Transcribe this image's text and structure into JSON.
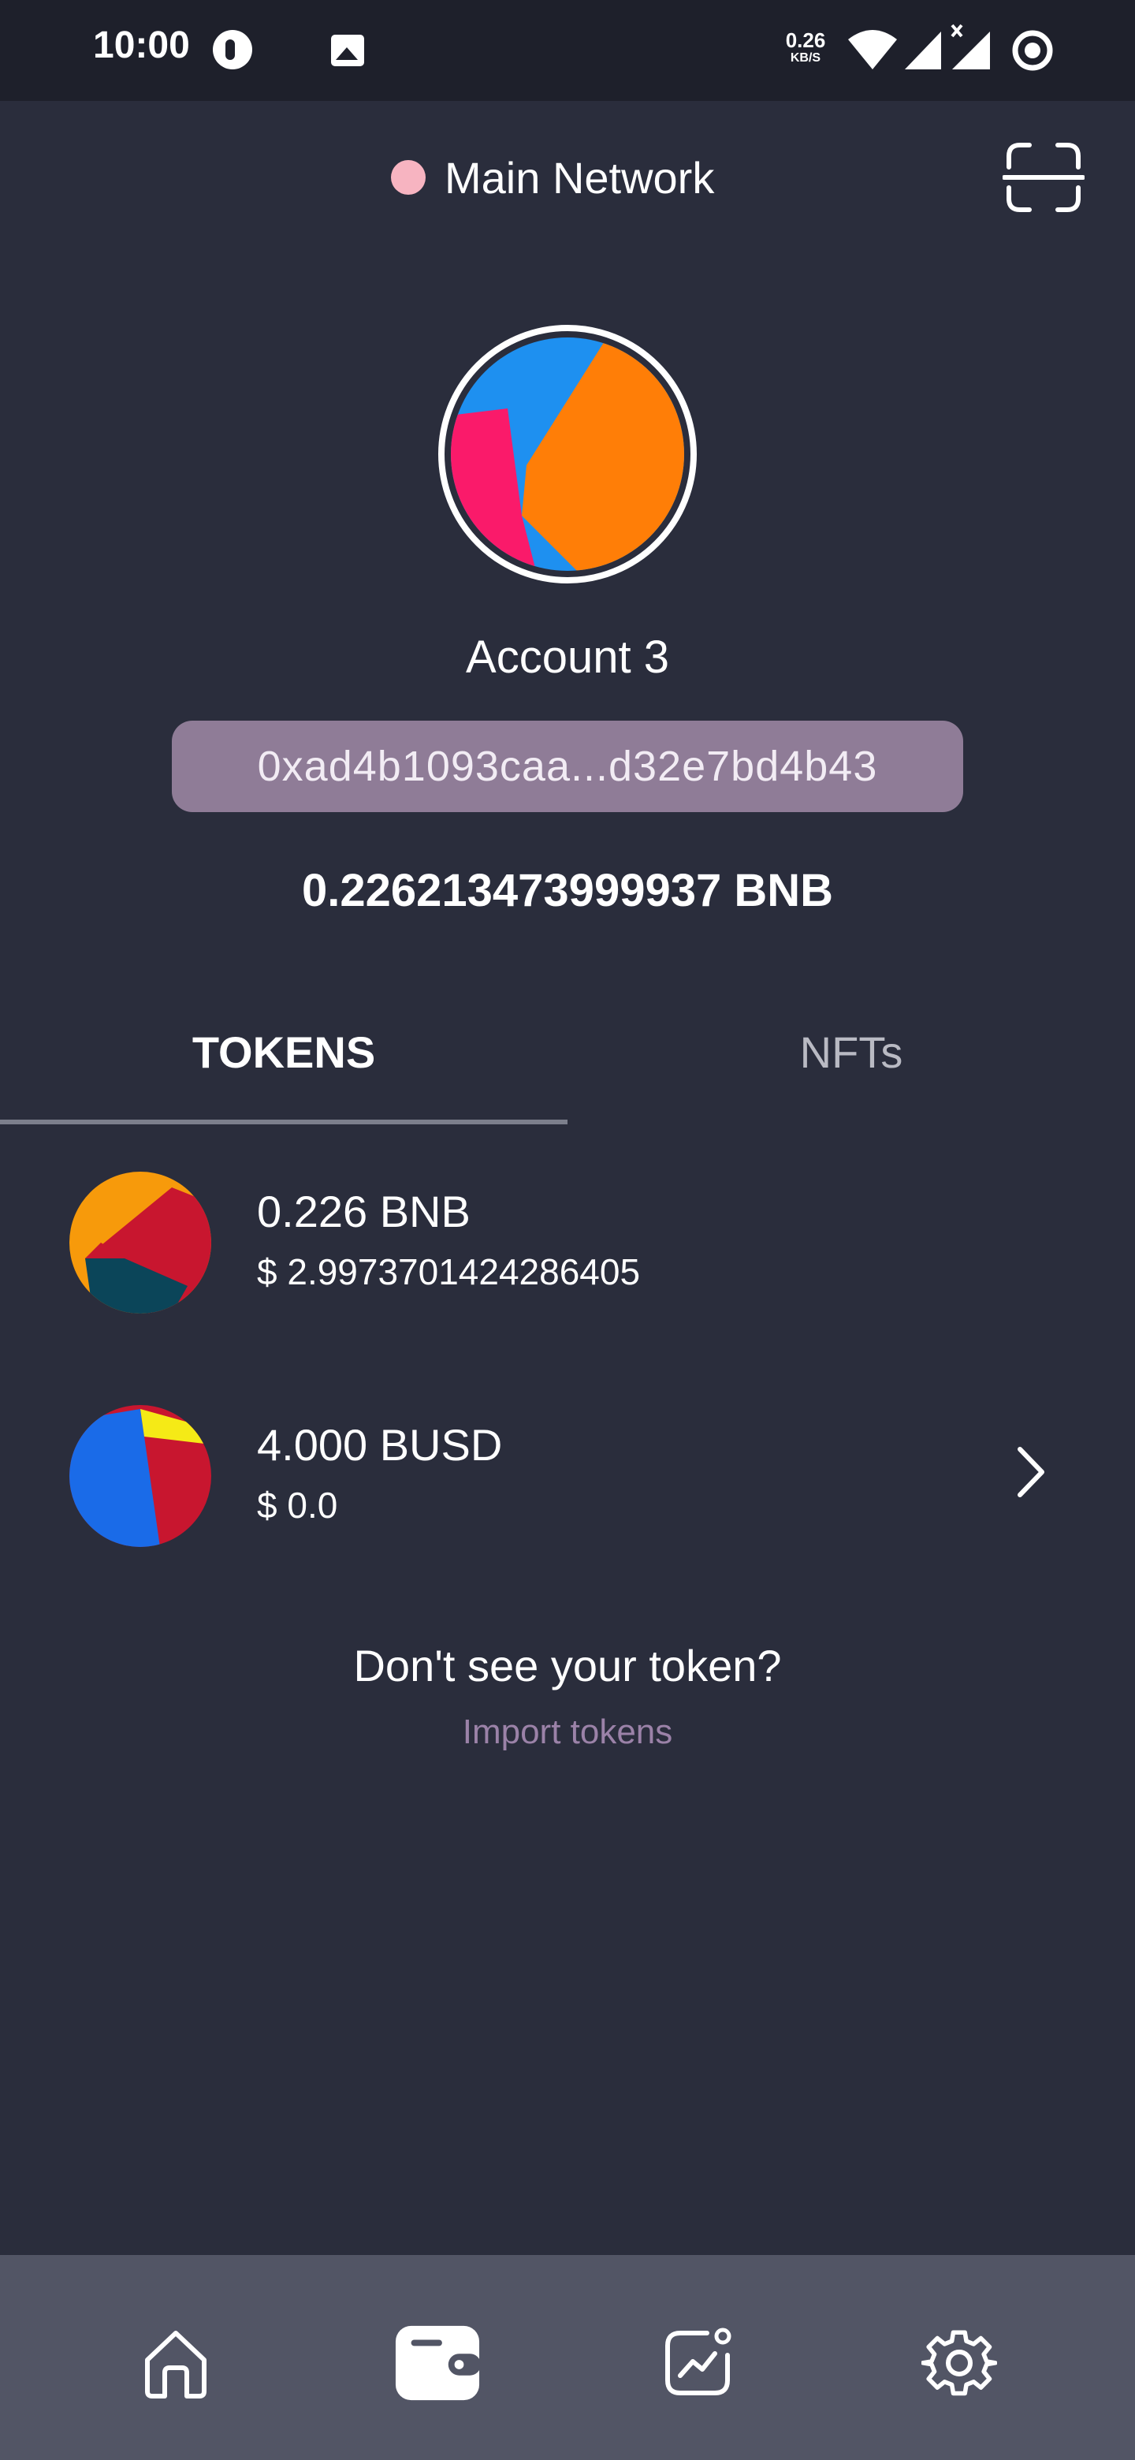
{
  "status_bar": {
    "time": "10:00",
    "net_speed_value": "0.26",
    "net_speed_unit": "KB/S",
    "icons": [
      "app-notification-icon",
      "gallery-icon",
      "wifi-icon",
      "signal-icon",
      "signal-no-data-icon",
      "record-icon"
    ]
  },
  "header": {
    "network_label": "Main Network",
    "network_dot_color": "#f7b4c1",
    "scan_icon": "scan-qr-icon"
  },
  "account": {
    "name": "Account 3",
    "address": "0xad4b1093caa...d32e7bd4b43",
    "balance": "0.226213473999937 BNB"
  },
  "tabs": [
    {
      "label": "TOKENS",
      "active": true
    },
    {
      "label": "NFTs",
      "active": false
    }
  ],
  "tokens": [
    {
      "amount": "0.226 BNB",
      "value": "$ 2.9973701424286405",
      "logo": "bnb-token-icon",
      "has_chevron": false
    },
    {
      "amount": "4.000 BUSD",
      "value": "$ 0.0",
      "logo": "busd-token-icon",
      "has_chevron": true
    }
  ],
  "footer": {
    "prompt": "Don't see your token?",
    "import_link": "Import tokens"
  },
  "bottom_nav": [
    {
      "icon": "home-icon",
      "active": false
    },
    {
      "icon": "wallet-icon",
      "active": true
    },
    {
      "icon": "chart-icon",
      "active": false
    },
    {
      "icon": "settings-icon",
      "active": false
    }
  ],
  "colors": {
    "background": "#2a2d3c",
    "status_bar": "#1e202b",
    "address_pill": "#8f7c97",
    "link": "#9b82a8",
    "bottom_nav": "#525565"
  }
}
